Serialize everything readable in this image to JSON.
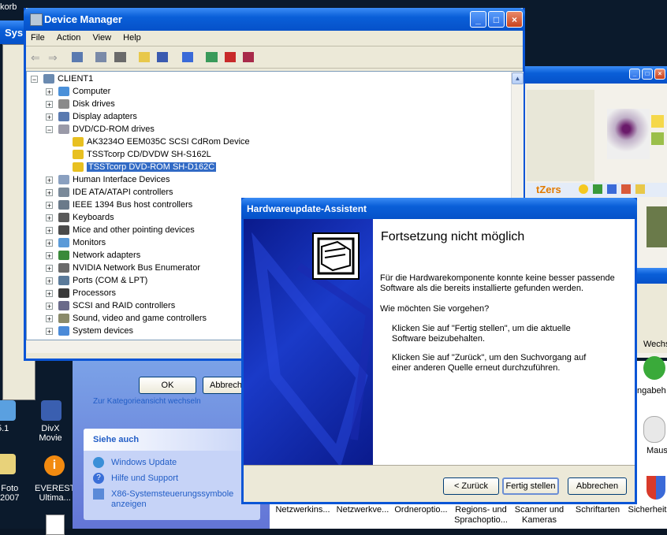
{
  "desktop": {
    "top_left_text": "korb",
    "icons": [
      {
        "label": "5.1"
      },
      {
        "label": "DivX Movie"
      },
      {
        "label": "Foto\n2007"
      },
      {
        "label": "EVEREST\nUltima..."
      }
    ]
  },
  "bg_window": {
    "title_fragment": "Sys"
  },
  "control_panel": {
    "toolbar_text": "tZers",
    "side_link_top": "Zur Kategorieansicht wechseln",
    "siehe_auch": {
      "heading": "Siehe auch",
      "links": [
        "Windows Update",
        "Hilfe und Support",
        "X86-Systemsteuerungssymbole\nanzeigen"
      ]
    },
    "icon_labels": [
      "Netzwerkins...",
      "Netzwerkve...",
      "Ordneroptio...",
      "Regions- und\nSprachoptio...",
      "Scanner und\nKameras",
      "Schriftarten",
      "Sicherheit"
    ],
    "right_labels": [
      "Wechs",
      "ngabeh",
      "Maus"
    ]
  },
  "device_manager": {
    "title": "Device Manager",
    "menu": [
      "File",
      "Action",
      "View",
      "Help"
    ],
    "root": "CLIENT1",
    "categories": [
      "Computer",
      "Disk drives",
      "Display adapters",
      "DVD/CD-ROM drives",
      "Human Interface Devices",
      "IDE ATA/ATAPI controllers",
      "IEEE 1394 Bus host controllers",
      "Keyboards",
      "Mice and other pointing devices",
      "Monitors",
      "Network adapters",
      "NVIDIA Network Bus Enumerator",
      "Ports (COM & LPT)",
      "Processors",
      "SCSI and RAID controllers",
      "Sound, video and game controllers",
      "System devices"
    ],
    "dvd_children": [
      "AK3234O EEM035C SCSI CdRom Device",
      "TSSTcorp CD/DVDW SH-S162L",
      "TSSTcorp DVD-ROM SH-D162C"
    ],
    "ok_label": "OK",
    "cancel_label": "Abbrech"
  },
  "wizard": {
    "title": "Hardwareupdate-Assistent",
    "heading": "Fortsetzung nicht möglich",
    "line1": "Für die Hardwarekomponente konnte keine besser passende",
    "line2": "Software als die bereits installierte gefunden werden.",
    "question": "Wie möchten Sie vorgehen?",
    "opt1a": "Klicken Sie auf \"Fertig stellen\", um die aktuelle",
    "opt1b": "Software beizubehalten.",
    "opt2a": "Klicken Sie auf \"Zurück\", um den Suchvorgang auf",
    "opt2b": "einer anderen Quelle erneut durchzuführen.",
    "back_label": "< Zurück",
    "finish_label": "Fertig stellen",
    "cancel_label": "Abbrechen"
  },
  "colors": {
    "xp_blue": "#0a55d6",
    "selection": "#316ac5",
    "dialog_bg": "#ece9d8",
    "wizard_art": "#0b1f9c"
  }
}
